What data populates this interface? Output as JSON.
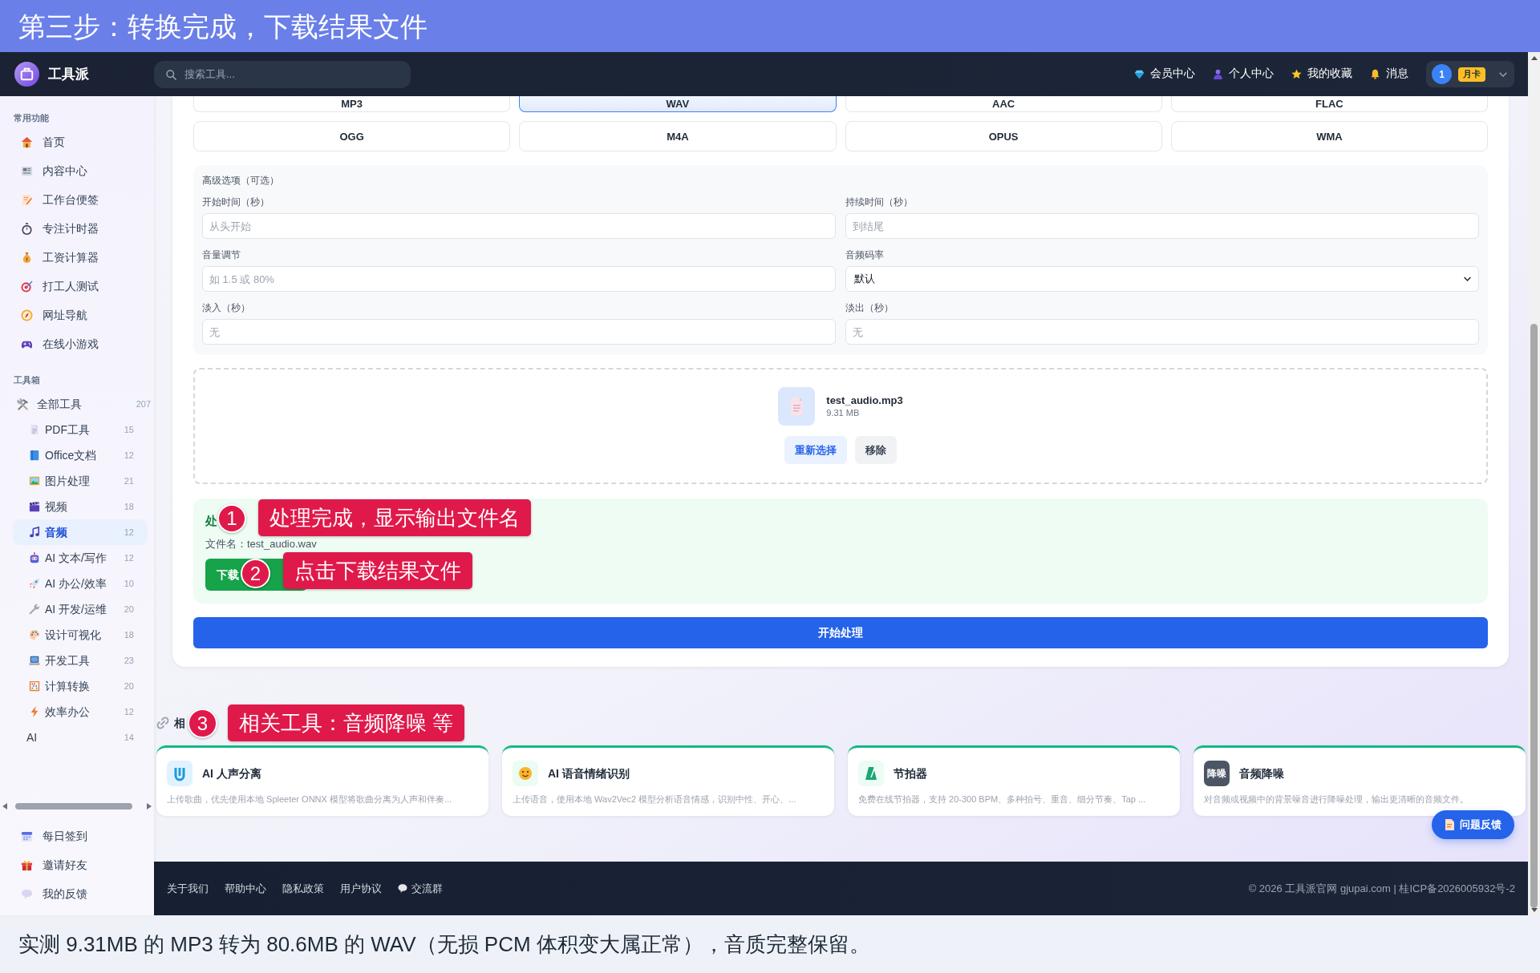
{
  "banner": {
    "title": "第三步：转换完成，下载结果文件"
  },
  "navbar": {
    "logo": "工具派",
    "search": {
      "placeholder": "搜索工具..."
    },
    "links": [
      {
        "label": "会员中心"
      },
      {
        "label": "个人中心"
      },
      {
        "label": "我的收藏"
      },
      {
        "label": "消息"
      }
    ],
    "user": {
      "avatar": "1",
      "plan": "月卡"
    }
  },
  "sidebar": {
    "sections": [
      {
        "title": "常用功能",
        "items": [
          {
            "label": "首页",
            "selected": false
          },
          {
            "label": "内容中心",
            "selected": false
          },
          {
            "label": "工作台便签",
            "selected": false
          },
          {
            "label": "专注计时器",
            "selected": false
          },
          {
            "label": "工资计算器",
            "selected": false
          },
          {
            "label": "打工人测试",
            "selected": false
          },
          {
            "label": "网址导航",
            "selected": false
          },
          {
            "label": "在线小游戏",
            "selected": false
          }
        ]
      },
      {
        "title": "工具箱",
        "items": [
          {
            "label": "全部工具",
            "count": "207",
            "selected": false,
            "children": [
              {
                "label": "PDF工具",
                "count": "15",
                "kind": "icon",
                "selected": false
              },
              {
                "label": "Office文档",
                "count": "12",
                "kind": "icon",
                "selected": false
              },
              {
                "label": "图片处理",
                "count": "21",
                "kind": "icon",
                "selected": false
              },
              {
                "label": "视频",
                "count": "18",
                "kind": "icon",
                "selected": false
              },
              {
                "label": "音频",
                "count": "12",
                "kind": "icon",
                "selected": true
              },
              {
                "label": "AI 文本/写作",
                "count": "12",
                "kind": "icon",
                "selected": false
              },
              {
                "label": "AI 办公/效率",
                "count": "10",
                "kind": "icon",
                "selected": false
              },
              {
                "label": "AI 开发/运维",
                "count": "20",
                "kind": "icon",
                "selected": false
              },
              {
                "label": "设计可视化",
                "count": "18",
                "kind": "icon",
                "selected": false
              },
              {
                "label": "开发工具",
                "count": "23",
                "kind": "icon",
                "selected": false
              },
              {
                "label": "计算转换",
                "count": "20",
                "kind": "icon",
                "selected": false
              },
              {
                "label": "效率办公",
                "count": "12",
                "kind": "icon",
                "selected": false
              },
              {
                "label": "AI",
                "count": "14",
                "kind": "plain",
                "selected": false
              }
            ]
          }
        ]
      }
    ],
    "bottom_items": [
      {
        "label": "每日签到",
        "selected": false
      },
      {
        "label": "邀请好友",
        "selected": false
      },
      {
        "label": "我的反馈",
        "selected": false
      }
    ]
  },
  "formats": [
    {
      "label": "MP3",
      "selected": false
    },
    {
      "label": "WAV",
      "selected": true
    },
    {
      "label": "AAC",
      "selected": false
    },
    {
      "label": "FLAC",
      "selected": false
    },
    {
      "label": "OGG",
      "selected": false
    },
    {
      "label": "M4A",
      "selected": false
    },
    {
      "label": "OPUS",
      "selected": false
    },
    {
      "label": "WMA",
      "selected": false
    }
  ],
  "advanced_options": {
    "title": "高级选项（可选）",
    "fields": [
      {
        "label": "开始时间（秒）",
        "kind": "input",
        "placeholder": "从头开始"
      },
      {
        "label": "持续时间（秒）",
        "kind": "input",
        "placeholder": "到结尾"
      },
      {
        "label": "音量调节",
        "kind": "input",
        "placeholder": "如 1.5 或 80%"
      },
      {
        "label": "音频码率",
        "kind": "select",
        "value": "默认"
      },
      {
        "label": "淡入（秒）",
        "kind": "input",
        "placeholder": "无"
      },
      {
        "label": "淡出（秒）",
        "kind": "input",
        "placeholder": "无"
      }
    ]
  },
  "upload": {
    "file_name": "test_audio.mp3",
    "file_size": "9.31 MB",
    "buttons": [
      {
        "label": "重新选择",
        "kind": "primary"
      },
      {
        "label": "移除",
        "kind": "secondary"
      }
    ]
  },
  "result": {
    "title": "处",
    "file_name": "文件名：test_audio.wav",
    "download_button": "下载"
  },
  "start_button": "开始处理",
  "related_tools": {
    "title": "相",
    "tools": [
      {
        "title": "AI 人声分离",
        "description": "上传歌曲，优先使用本地 Spleeter ONNX 模型将歌曲分离为人声和伴奏..."
      },
      {
        "title": "AI 语音情绪识别",
        "description": "上传语音，使用本地 Wav2Vec2 模型分析语音情感，识别中性、开心、..."
      },
      {
        "title": "节拍器",
        "description": "免费在线节拍器，支持 20-300 BPM、多种拍号、重音、细分节奏、Tap ..."
      },
      {
        "title": "音频降噪",
        "icon_text": "降噪",
        "description": "对音频或视频中的背景噪音进行降噪处理，输出更清晰的音频文件。"
      }
    ]
  },
  "feedback_button": "问题反馈",
  "footer": {
    "links": [
      {
        "label": "关于我们",
        "kind": "text"
      },
      {
        "label": "帮助中心",
        "kind": "text"
      },
      {
        "label": "隐私政策",
        "kind": "text"
      },
      {
        "label": "用户协议",
        "kind": "text"
      },
      {
        "label": "交流群",
        "kind": "chat"
      }
    ],
    "copyright": "© 2026 工具派官网 gjupai.com | 桂ICP备2026005932号-2"
  },
  "annotations": [
    {
      "number": "1",
      "text": "处理完成，显示输出文件名"
    },
    {
      "number": "2",
      "text": "点击下载结果文件"
    },
    {
      "number": "3",
      "text": "相关工具：音频降噪 等"
    }
  ],
  "caption": "实测 9.31MB 的 MP3 转为 80.6MB 的 WAV（无损 PCM 体积变大属正常），音质完整保留。"
}
